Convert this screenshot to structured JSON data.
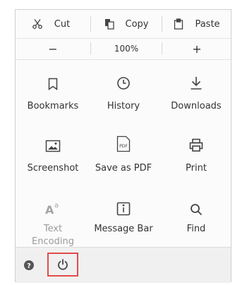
{
  "edit": {
    "cut_label": "Cut",
    "copy_label": "Copy",
    "paste_label": "Paste"
  },
  "zoom": {
    "out_label": "−",
    "level": "100%",
    "in_label": "+"
  },
  "grid": [
    {
      "label": "Bookmarks",
      "icon": "bookmark-icon"
    },
    {
      "label": "History",
      "icon": "history-icon"
    },
    {
      "label": "Downloads",
      "icon": "download-icon"
    },
    {
      "label": "Screenshot",
      "icon": "screenshot-icon"
    },
    {
      "label": "Save as PDF",
      "icon": "pdf-icon"
    },
    {
      "label": "Print",
      "icon": "print-icon"
    },
    {
      "label": "Text\nEncoding",
      "icon": "text-encoding-icon",
      "disabled": true
    },
    {
      "label": "Message Bar",
      "icon": "message-bar-icon"
    },
    {
      "label": "Find",
      "icon": "search-icon"
    }
  ],
  "footer": {
    "help_icon": "help-icon",
    "power_icon": "power-icon",
    "highlight_color": "#e34b4b"
  }
}
